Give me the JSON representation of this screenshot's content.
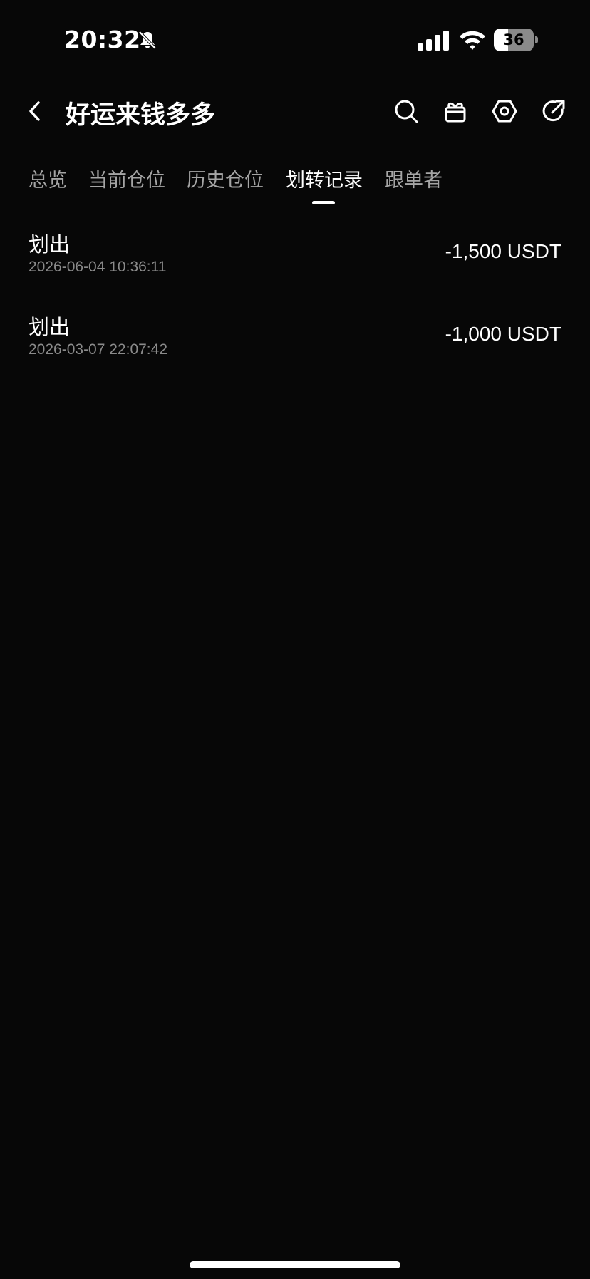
{
  "status_bar": {
    "time": "20:32",
    "battery": "36"
  },
  "header": {
    "title": "好运来钱多多"
  },
  "icons": {
    "back": "chevron-left-icon",
    "search": "search-icon",
    "gift": "gift-icon",
    "settings": "hexagon-settings-icon",
    "share": "share-arrow-icon",
    "bell": "bell-muted-icon"
  },
  "tabs": [
    {
      "label": "总览"
    },
    {
      "label": "当前仓位"
    },
    {
      "label": "历史仓位"
    },
    {
      "label": "划转记录"
    },
    {
      "label": "跟单者"
    }
  ],
  "active_tab": "划转记录",
  "records": [
    {
      "type": "划出",
      "time": "2026-06-04 10:36:11",
      "amount": "-1,500 USDT"
    },
    {
      "type": "划出",
      "time": "2026-03-07 22:07:42",
      "amount": "-1,000 USDT"
    }
  ]
}
